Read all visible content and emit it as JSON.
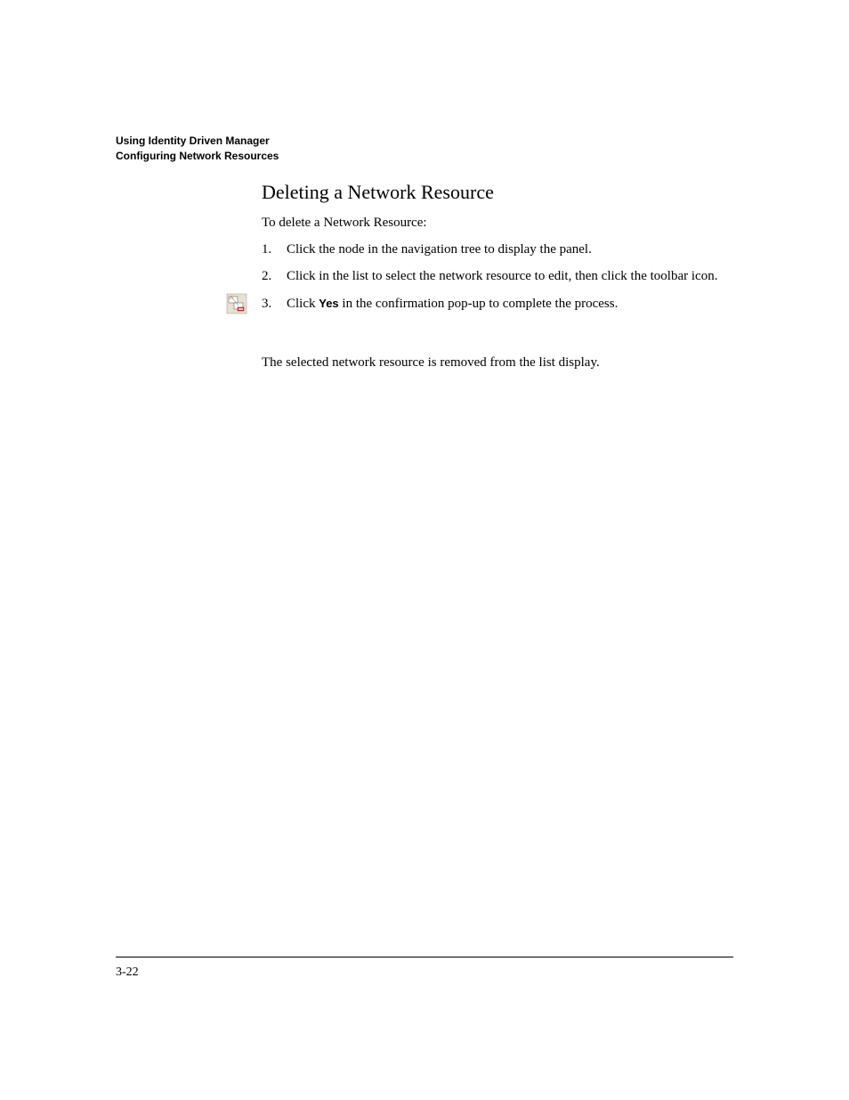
{
  "header": {
    "line1": "Using Identity Driven Manager",
    "line2": "Configuring Network Resources"
  },
  "section": {
    "title": "Deleting a Network Resource",
    "intro": "To delete a Network Resource:"
  },
  "steps": {
    "item1": {
      "number": "1.",
      "part1": "Click the ",
      "part2": " node in the navigation tree to display the ",
      "part3": " panel."
    },
    "item2": {
      "number": "2.",
      "part1": "Click in the list to select the network resource to edit, then click the ",
      "part2": " toolbar icon."
    },
    "item3": {
      "number": "3.",
      "part1": "Click ",
      "yes": "Yes",
      "part2": " in the confirmation pop-up to complete the process."
    }
  },
  "closing": {
    "part1": "The selected network resource is removed from the ",
    "part2": " list display."
  },
  "footer": {
    "pageNumber": "3-22"
  }
}
